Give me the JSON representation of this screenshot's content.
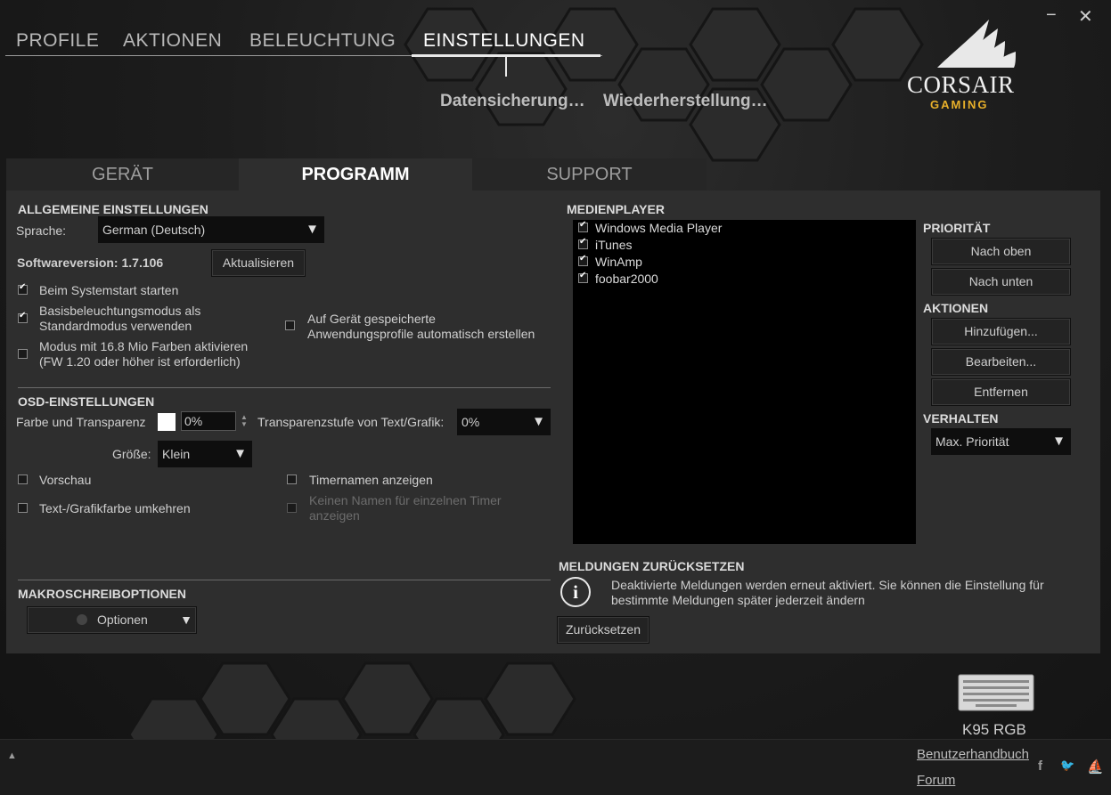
{
  "window": {
    "minimize_label": "−",
    "close_label": "✕"
  },
  "main_nav": {
    "tabs": [
      {
        "label": "PROFILE"
      },
      {
        "label": "AKTIONEN"
      },
      {
        "label": "BELEUCHTUNG"
      },
      {
        "label": "EINSTELLUNGEN"
      }
    ],
    "active": "EINSTELLUNGEN"
  },
  "sub_nav": {
    "backup_label": "Datensicherung…",
    "restore_label": "Wiederherstellung…"
  },
  "logo": {
    "word": "CORSAIR",
    "sub": "GAMING"
  },
  "settings_tabs": [
    {
      "label": "GERÄT"
    },
    {
      "label": "PROGRAMM"
    },
    {
      "label": "SUPPORT"
    }
  ],
  "general": {
    "title": "ALLGEMEINE EINSTELLUNGEN",
    "language_label": "Sprache:",
    "language_value": "German (Deutsch)",
    "software_version": "Softwareversion: 1.7.106",
    "update_button": "Aktualisieren",
    "opt_startup": "Beim Systemstart starten",
    "opt_basic_line1": "Basisbeleuchtungsmodus als",
    "opt_basic_line2": "Standardmodus verwenden",
    "opt_16m_line1": "Modus mit 16.8 Mio Farben aktivieren",
    "opt_16m_line2": "(FW 1.20 oder höher ist erforderlich)",
    "opt_profiles_line1": "Auf Gerät gespeicherte",
    "opt_profiles_line2": "Anwendungsprofile automatisch erstellen",
    "checked": {
      "startup": true,
      "basic": true,
      "m16": false,
      "profiles": false
    }
  },
  "osd": {
    "title": "OSD-EINSTELLUNGEN",
    "color_label": "Farbe und Transparenz",
    "color_value": "#ffffff",
    "transparency_value": "0%",
    "text_transparency_label": "Transparenzstufe von Text/Grafik:",
    "text_transparency_value": "0%",
    "size_label": "Größe:",
    "size_value": "Klein",
    "preview_label": "Vorschau",
    "invert_label": "Text-/Grafikfarbe umkehren",
    "timer_names_label": "Timernamen anzeigen",
    "no_names_line1": "Keinen Namen für einzelnen Timer",
    "no_names_line2": "anzeigen"
  },
  "macro": {
    "title": "MAKROSCHREIBOPTIONEN",
    "options_label": "Optionen"
  },
  "media": {
    "title": "MEDIENPLAYER",
    "players": [
      {
        "name": "Windows Media Player",
        "checked": true
      },
      {
        "name": "iTunes",
        "checked": true
      },
      {
        "name": "WinAmp",
        "checked": true
      },
      {
        "name": "foobar2000",
        "checked": true
      }
    ],
    "priority_title": "PRIORITÄT",
    "up_button": "Nach oben",
    "down_button": "Nach unten",
    "actions_title": "AKTIONEN",
    "add_button": "Hinzufügen...",
    "edit_button": "Bearbeiten...",
    "remove_button": "Entfernen",
    "behavior_title": "VERHALTEN",
    "behavior_value": "Max. Priorität"
  },
  "reset": {
    "title": "MELDUNGEN ZURÜCKSETZEN",
    "info_icon": "i",
    "text_line1": "Deaktivierte Meldungen werden erneut aktiviert. Sie können die Einstellung für",
    "text_line2": "bestimmte Meldungen später jederzeit ändern",
    "button": "Zurücksetzen"
  },
  "device": {
    "name": "K95 RGB",
    "icon": "keyboard-icon"
  },
  "footer": {
    "manual_link": "Benutzerhandbuch",
    "forum_link": "Forum",
    "expand_arrow": "▲",
    "social": [
      {
        "icon": "facebook-icon",
        "glyph": "f"
      },
      {
        "icon": "twitter-icon",
        "glyph": "🐦"
      },
      {
        "icon": "corsair-sails-icon",
        "glyph": "⛵"
      }
    ]
  }
}
